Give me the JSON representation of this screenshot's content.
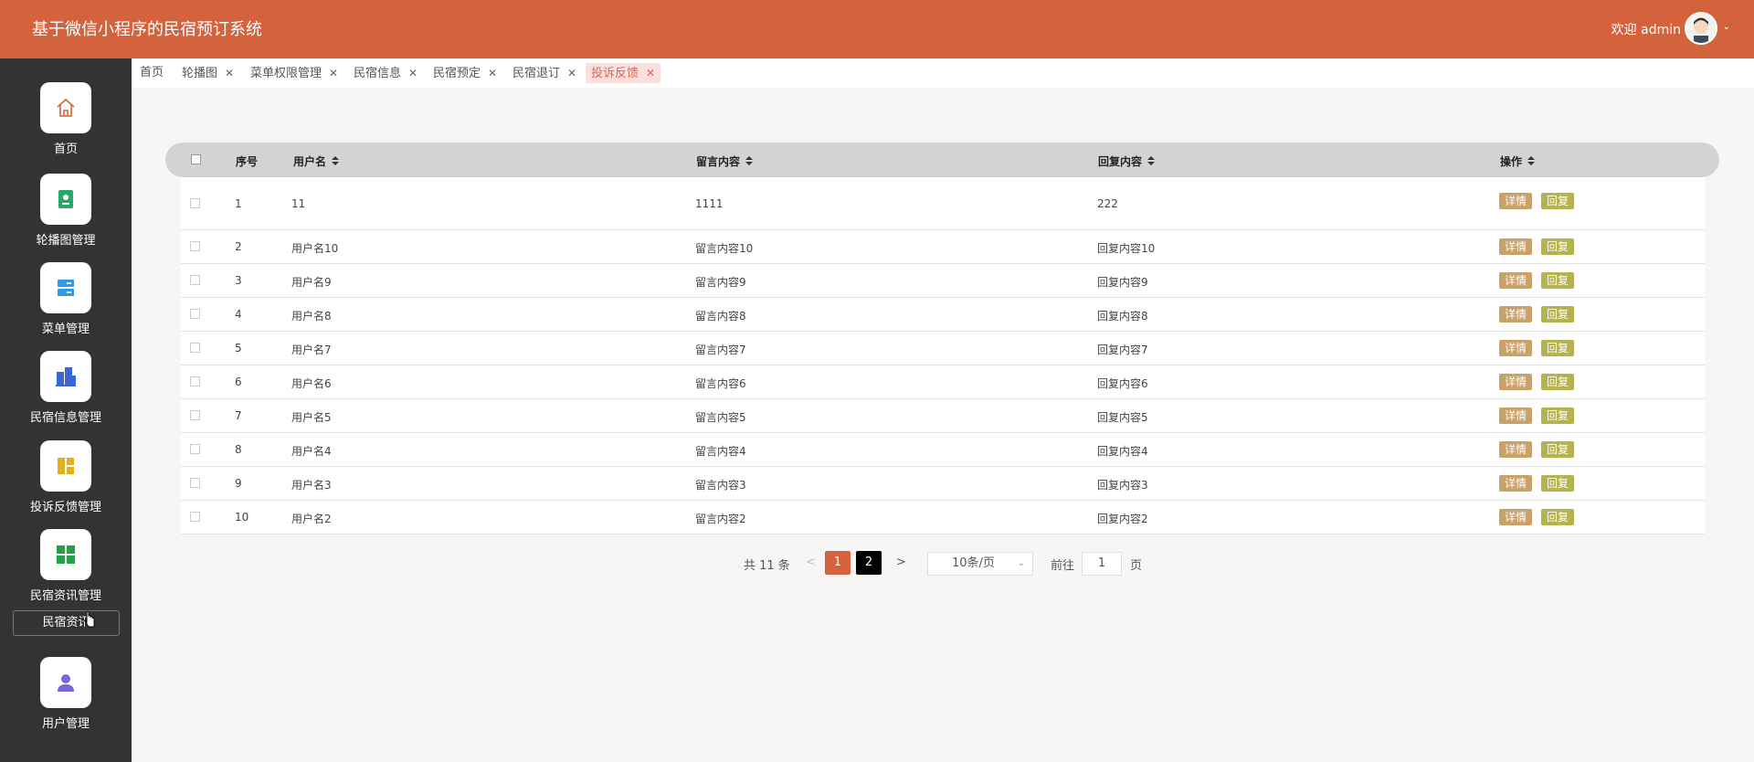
{
  "header": {
    "title": "基于微信小程序的民宿预订系统",
    "welcome": "欢迎 admin"
  },
  "sidebar": {
    "items": [
      {
        "label": "首页",
        "icon": "home-icon",
        "color": "#d4623c"
      },
      {
        "label": "轮播图管理",
        "icon": "carousel-icon",
        "color": "#2aa86b"
      },
      {
        "label": "菜单管理",
        "icon": "menu-icon",
        "color": "#2f9be0"
      },
      {
        "label": "民宿信息管理",
        "icon": "building-icon",
        "color": "#3a66d6"
      },
      {
        "label": "投诉反馈管理",
        "icon": "feedback-icon",
        "color": "#e2b21e"
      },
      {
        "label": "民宿资讯管理",
        "icon": "grid-icon",
        "color": "#23a04a"
      },
      {
        "label": "用户管理",
        "icon": "user-icon",
        "color": "#7b66d8"
      }
    ],
    "submenu_label": "民宿资讯"
  },
  "tabs": [
    {
      "label": "首页",
      "closable": false
    },
    {
      "label": "轮播图",
      "closable": true
    },
    {
      "label": "菜单权限管理",
      "closable": true
    },
    {
      "label": "民宿信息",
      "closable": true
    },
    {
      "label": "民宿预定",
      "closable": true
    },
    {
      "label": "民宿退订",
      "closable": true
    },
    {
      "label": "投诉反馈",
      "closable": true,
      "active": true
    }
  ],
  "table": {
    "columns": [
      "序号",
      "用户名",
      "留言内容",
      "回复内容",
      "操作"
    ],
    "detail_label": "详情",
    "reply_label": "回复",
    "rows": [
      {
        "index": "1",
        "username": "11",
        "content": "1111",
        "reply": "222"
      },
      {
        "index": "2",
        "username": "用户名10",
        "content": "留言内容10",
        "reply": "回复内容10"
      },
      {
        "index": "3",
        "username": "用户名9",
        "content": "留言内容9",
        "reply": "回复内容9"
      },
      {
        "index": "4",
        "username": "用户名8",
        "content": "留言内容8",
        "reply": "回复内容8"
      },
      {
        "index": "5",
        "username": "用户名7",
        "content": "留言内容7",
        "reply": "回复内容7"
      },
      {
        "index": "6",
        "username": "用户名6",
        "content": "留言内容6",
        "reply": "回复内容6"
      },
      {
        "index": "7",
        "username": "用户名5",
        "content": "留言内容5",
        "reply": "回复内容5"
      },
      {
        "index": "8",
        "username": "用户名4",
        "content": "留言内容4",
        "reply": "回复内容4"
      },
      {
        "index": "9",
        "username": "用户名3",
        "content": "留言内容3",
        "reply": "回复内容3"
      },
      {
        "index": "10",
        "username": "用户名2",
        "content": "留言内容2",
        "reply": "回复内容2"
      }
    ]
  },
  "pagination": {
    "total_text": "共 11 条",
    "prev": "<",
    "pages": [
      "1",
      "2"
    ],
    "current_page": "1",
    "next": ">",
    "page_size": "10条/页",
    "goto_label": "前往",
    "goto_value": "1",
    "page_suffix": "页"
  },
  "colors": {
    "header_bg": "#d4623c",
    "sidebar_bg": "#333333",
    "detail_button": "#c8a26a",
    "reply_button": "#b5b34e",
    "active_tab_bg": "#fbe0dc",
    "active_tab_text": "#e0635a"
  }
}
